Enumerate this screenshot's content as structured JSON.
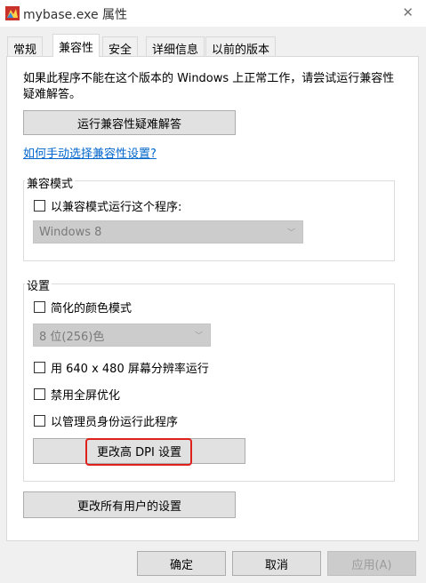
{
  "window": {
    "title": "mybase.exe 属性",
    "icons": {
      "app": "app-logo-icon",
      "close": "close-icon"
    }
  },
  "tabs": [
    {
      "label": "常规"
    },
    {
      "label": "兼容性"
    },
    {
      "label": "安全"
    },
    {
      "label": "详细信息"
    },
    {
      "label": "以前的版本"
    }
  ],
  "main": {
    "description": "如果此程序不能在这个版本的 Windows 上正常工作，请尝试运行兼容性疑难解答。",
    "troubleshoot_button": "运行兼容性疑难解答",
    "manual_link": "如何手动选择兼容性设置?"
  },
  "compat_mode": {
    "group_label": "兼容模式",
    "checkbox_label": "以兼容模式运行这个程序:",
    "checked": false,
    "select_value": "Windows 8"
  },
  "settings": {
    "group_label": "设置",
    "reduced_color": {
      "label": "简化的颜色模式",
      "checked": false
    },
    "color_select_value": "8 位(256)色",
    "res640": {
      "label": "用 640 x 480 屏幕分辨率运行",
      "checked": false
    },
    "disable_fullscreen": {
      "label": "禁用全屏优化",
      "checked": false
    },
    "run_as_admin": {
      "label": "以管理员身份运行此程序",
      "checked": false
    },
    "dpi_button": "更改高 DPI 设置"
  },
  "all_users_button": "更改所有用户的设置",
  "footer": {
    "ok": "确定",
    "cancel": "取消",
    "apply": "应用(A)"
  },
  "colors": {
    "highlight_border": "#e0201a",
    "link": "#0066cc"
  }
}
